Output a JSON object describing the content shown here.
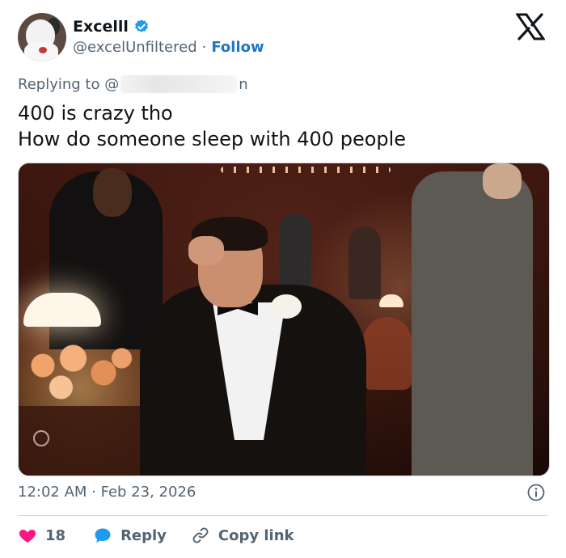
{
  "author": {
    "display_name": "Excelll",
    "handle": "@excelUnfiltered",
    "separator": "·",
    "follow_label": "Follow"
  },
  "reply": {
    "prefix": "Replying to @",
    "handle_suffix": "n"
  },
  "tweet": {
    "line1": "400 is crazy tho",
    "line2": "How do someone sleep with 400 people"
  },
  "meta": {
    "timestamp": "12:02 AM · Feb 23, 2026"
  },
  "actions": {
    "like_count": "18",
    "reply_label": "Reply",
    "copy_label": "Copy link"
  },
  "colors": {
    "like": "#f91880",
    "reply": "#1d9bf0",
    "link": "#1d77c9",
    "verified": "#1d9bf0"
  },
  "icons": {
    "verified": "verified-badge-icon",
    "brand": "x-logo-icon",
    "info": "info-icon",
    "like": "heart-icon",
    "reply": "speech-bubble-icon",
    "copy": "link-icon"
  }
}
